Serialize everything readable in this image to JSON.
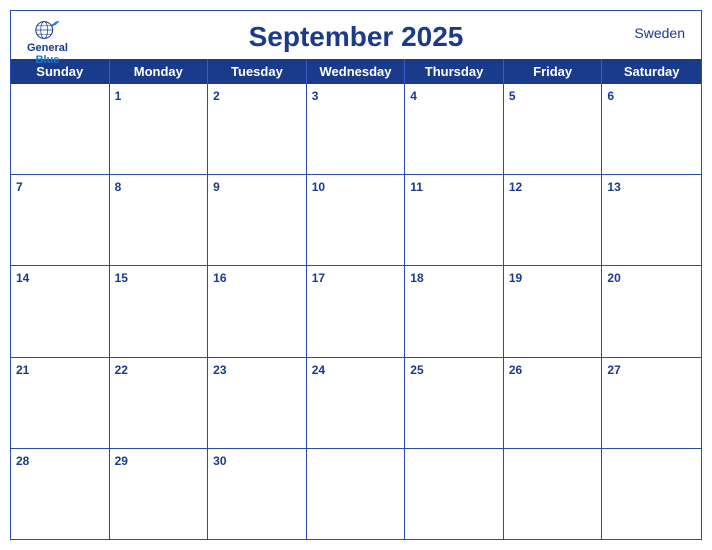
{
  "header": {
    "title": "September 2025",
    "country": "Sweden",
    "logo": {
      "line1": "General",
      "line2": "Blue"
    }
  },
  "days": [
    "Sunday",
    "Monday",
    "Tuesday",
    "Wednesday",
    "Thursday",
    "Friday",
    "Saturday"
  ],
  "weeks": [
    [
      {
        "num": "",
        "empty": true
      },
      {
        "num": "1"
      },
      {
        "num": "2"
      },
      {
        "num": "3"
      },
      {
        "num": "4"
      },
      {
        "num": "5"
      },
      {
        "num": "6"
      }
    ],
    [
      {
        "num": "7"
      },
      {
        "num": "8"
      },
      {
        "num": "9"
      },
      {
        "num": "10"
      },
      {
        "num": "11"
      },
      {
        "num": "12"
      },
      {
        "num": "13"
      }
    ],
    [
      {
        "num": "14"
      },
      {
        "num": "15"
      },
      {
        "num": "16"
      },
      {
        "num": "17"
      },
      {
        "num": "18"
      },
      {
        "num": "19"
      },
      {
        "num": "20"
      }
    ],
    [
      {
        "num": "21"
      },
      {
        "num": "22"
      },
      {
        "num": "23"
      },
      {
        "num": "24"
      },
      {
        "num": "25"
      },
      {
        "num": "26"
      },
      {
        "num": "27"
      }
    ],
    [
      {
        "num": "28"
      },
      {
        "num": "29"
      },
      {
        "num": "30"
      },
      {
        "num": "",
        "empty": true
      },
      {
        "num": "",
        "empty": true
      },
      {
        "num": "",
        "empty": true
      },
      {
        "num": "",
        "empty": true
      }
    ]
  ]
}
